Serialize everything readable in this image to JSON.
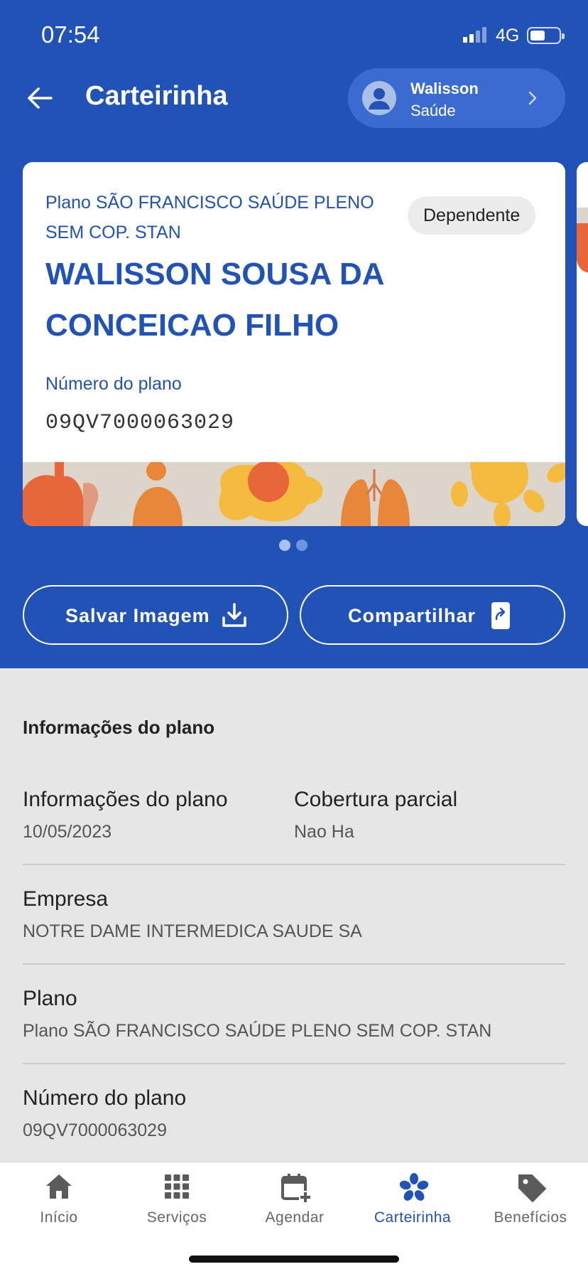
{
  "status_bar": {
    "time": "07:54",
    "network": "4G"
  },
  "header": {
    "title": "Carteirinha"
  },
  "profile": {
    "name": "Walisson",
    "subtitle": "Saúde"
  },
  "card": {
    "plan_name": "Plano SÃO FRANCISCO SAÚDE PLENO SEM COP. STAN",
    "badge": "Dependente",
    "member_name": "WALISSON SOUSA DA CONCEICAO FILHO",
    "plan_number_label": "Número do plano",
    "plan_number": "09QV7000063029"
  },
  "carousel": {
    "pages": 2,
    "active": 1
  },
  "actions": {
    "save": "Salvar Imagem",
    "share": "Compartilhar"
  },
  "info": {
    "section_title": "Informações do plano",
    "date_label": "Informações do plano",
    "date_value": "10/05/2023",
    "coverage_label": "Cobertura parcial",
    "coverage_value": "Nao Ha",
    "company_label": "Empresa",
    "company_value": "NOTRE DAME INTERMEDICA SAUDE SA",
    "plan_label": "Plano",
    "plan_value": "Plano SÃO FRANCISCO SAÚDE PLENO SEM COP. STAN",
    "number_label": "Número do plano",
    "number_value": "09QV7000063029"
  },
  "nav": {
    "home": "Início",
    "services": "Serviços",
    "schedule": "Agendar",
    "card": "Carteirinha",
    "benefits": "Benefícios"
  },
  "colors": {
    "primary": "#2152b5",
    "background": "#e6e6e6",
    "accent_orange": "#e8663a",
    "accent_yellow": "#f4bb3f"
  }
}
